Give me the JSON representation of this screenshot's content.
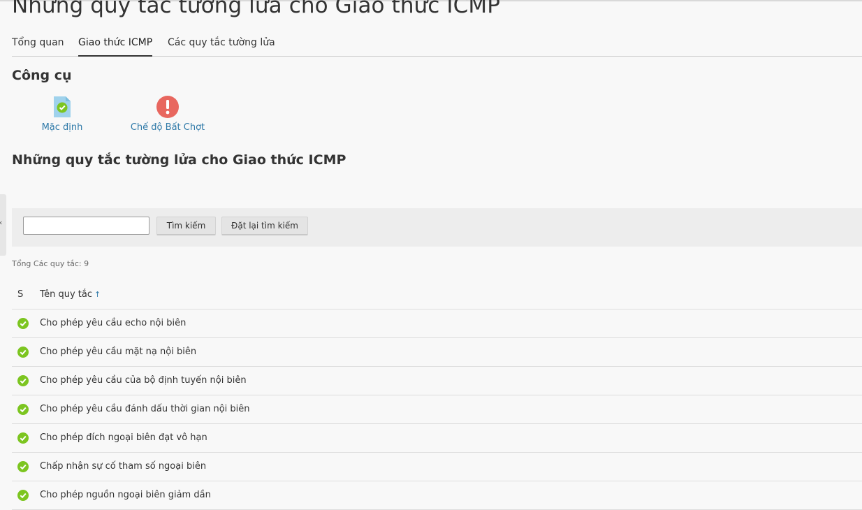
{
  "page": {
    "title": "Những quy tắc tường lửa cho Giao thức ICMP"
  },
  "tabs": [
    {
      "label": "Tổng quan",
      "active": false
    },
    {
      "label": "Giao thức ICMP",
      "active": true
    },
    {
      "label": "Các quy tắc tường lửa",
      "active": false
    }
  ],
  "tools": {
    "heading": "Công cụ",
    "items": [
      {
        "label": "Mặc định",
        "icon": "default-doc-check-icon"
      },
      {
        "label": "Chế độ Bất Chợt",
        "icon": "alert-exclamation-icon"
      }
    ]
  },
  "rules_section": {
    "heading": "Những quy tắc tường lửa cho Giao thức ICMP"
  },
  "search": {
    "value": "",
    "placeholder": "",
    "search_label": "Tìm kiếm",
    "reset_label": "Đặt lại tìm kiếm"
  },
  "total_label": "Tổng Các quy tắc: 9",
  "table": {
    "headers": {
      "status": "S",
      "name": "Tên quy tắc",
      "sort_indicator": "↑"
    },
    "rows": [
      {
        "name": "Cho phép yêu cầu echo nội biên",
        "status": "enabled"
      },
      {
        "name": "Cho phép yêu cầu mặt nạ nội biên",
        "status": "enabled"
      },
      {
        "name": "Cho phép yêu cầu của bộ định tuyến nội biên",
        "status": "enabled"
      },
      {
        "name": "Cho phép yêu cầu đánh dấu thời gian nội biên",
        "status": "enabled"
      },
      {
        "name": "Cho phép đích ngoại biên đạt vô hạn",
        "status": "enabled"
      },
      {
        "name": "Chấp nhận sự cố tham số ngoại biên",
        "status": "enabled"
      },
      {
        "name": "Cho phép nguồn ngoại biên giảm dần",
        "status": "enabled"
      }
    ]
  },
  "colors": {
    "link": "#2e79a8",
    "enabled": "#7cc520",
    "alert": "#e8675f",
    "doc": "#9fd2ec"
  }
}
